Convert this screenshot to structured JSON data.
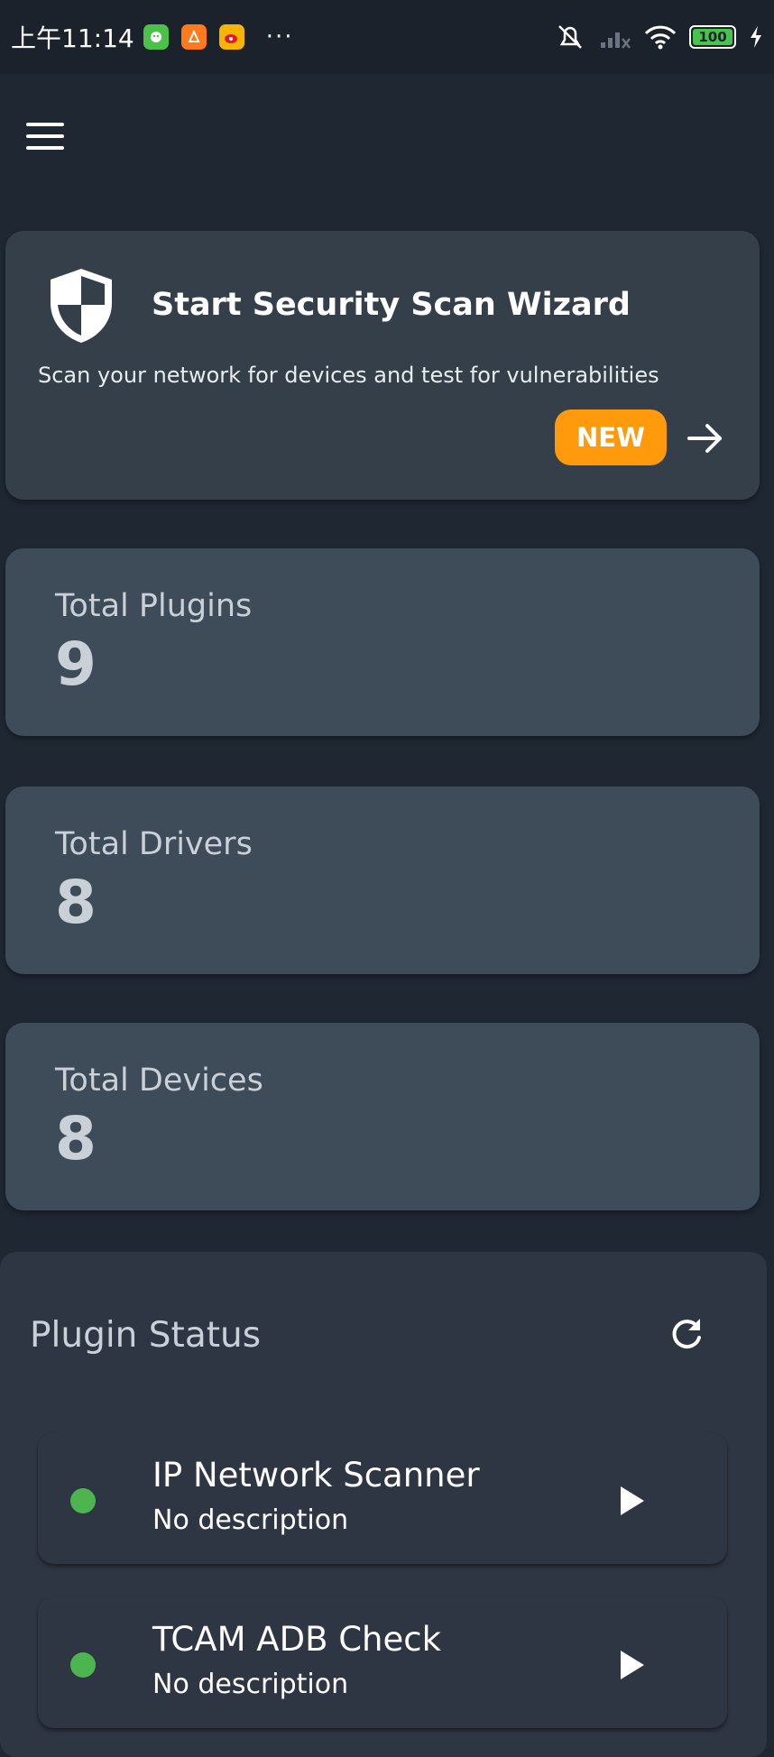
{
  "status_bar": {
    "time": "上午11:14",
    "more": "···",
    "battery": "100",
    "apps": [
      {
        "name": "wechat-like-app-icon",
        "color": "#4cc14a"
      },
      {
        "name": "orange-app-icon",
        "color": "#ff7a1a"
      },
      {
        "name": "weibo-icon",
        "color": "#f7b500"
      }
    ]
  },
  "wizard": {
    "title": "Start Security Scan Wizard",
    "description": "Scan your network for devices and test for vulnerabilities",
    "badge": "NEW",
    "badge_color": "#ff9a0d"
  },
  "stats": [
    {
      "label": "Total Plugins",
      "value": "9"
    },
    {
      "label": "Total Drivers",
      "value": "8"
    },
    {
      "label": "Total Devices",
      "value": "8"
    }
  ],
  "plugin_status": {
    "title": "Plugin Status",
    "plugins": [
      {
        "name": "IP Network Scanner",
        "description": "No description",
        "status_color": "#4cb54f"
      },
      {
        "name": "TCAM ADB Check",
        "description": "No description",
        "status_color": "#4cb54f"
      }
    ]
  }
}
